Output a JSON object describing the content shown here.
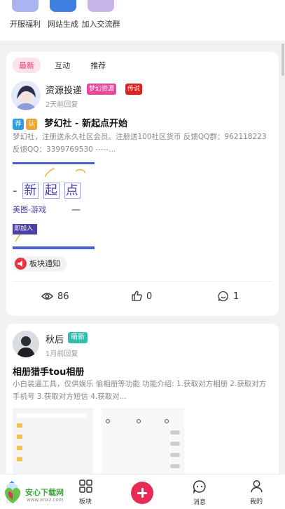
{
  "shortcuts": [
    {
      "label": "开服福利",
      "color": "#a9b4f0"
    },
    {
      "label": "网站生成",
      "color": "#3e7fe0"
    },
    {
      "label": "加入交流群",
      "color": "#c8b4e6"
    }
  ],
  "tabs": [
    "最新",
    "互动",
    "推荐"
  ],
  "post1": {
    "author": "资源投递",
    "badges": [
      "梦幻资源",
      "传说"
    ],
    "time": "2天前回复",
    "tag_boxes": [
      "荐",
      "认"
    ],
    "title": "梦幻社 - 新起点开始",
    "excerpt": "梦幻社，注册送永久社区会员。注册送100社区货币 反馈QQ群：962118223 反馈QQ：3399769530 -----...",
    "image": {
      "chars": [
        "新",
        "起",
        "点"
      ],
      "left_char": "-",
      "subtitle": "美图-游戏",
      "dash": "一",
      "button_text": "即加入"
    },
    "board": "板块通知",
    "views": "86",
    "likes": "0",
    "comments": "1"
  },
  "post2": {
    "author": "秋后",
    "badge": "萌新",
    "time": "1月前回复",
    "title": "相册猎手tou相册",
    "excerpt": "小白装逼工具，仅供娱乐 偷相册等功能 功能介绍: 1.获取对方相册 2.获取对方手机号 3.获取对方短信 4.获取对..."
  },
  "nav": {
    "home": "首页",
    "board": "板块",
    "messages": "消息",
    "mine": "我的"
  },
  "watermark": {
    "text": "安心下载网",
    "url": "www.anxz.com"
  },
  "colors": {
    "accent": "#e6336b",
    "fab": "#ea2a56"
  }
}
